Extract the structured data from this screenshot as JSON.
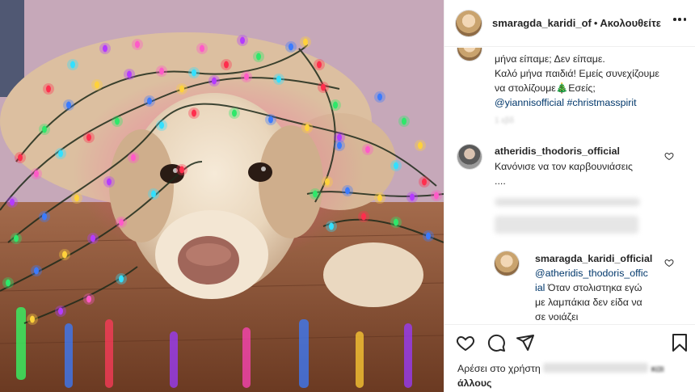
{
  "header": {
    "username": "smaragda_karidi_of",
    "separator": "•",
    "follow_label": "Ακολουθείτε"
  },
  "caption": {
    "line1": "μήνα είπαμε; Δεν είπαμε.",
    "line2": "Καλό μήνα παιδιά! Εμείς συνεχίζουμε",
    "line3a": "να στολίζουμε",
    "line3b": "Εσείς;",
    "mention": "@yiannisofficial",
    "hashtag": "#christmasspirit",
    "time": "1 εβδ"
  },
  "comments": [
    {
      "username": "atheridis_thodoris_official",
      "text": "Κανόνισε να τον καρβουνιάσεις",
      "text2": "...."
    }
  ],
  "reply": {
    "username": "smaragda_karidi_official",
    "mention_a": "@atheridis_thodoris_offic",
    "mention_b": "ial",
    "text_a": "Όταν στολιστηκα εγώ",
    "text_b": "με λαμπάκια δεν είδα να",
    "text_c": "σε νοιάζει"
  },
  "likes": {
    "prefix": "Αρέσει στο χρήστη",
    "suffix": "και",
    "others": "άλλους"
  },
  "icons": {
    "like": "heart-icon",
    "comment": "comment-icon",
    "share": "paper-plane-icon",
    "save": "bookmark-icon",
    "more": "more-horizontal-icon"
  }
}
